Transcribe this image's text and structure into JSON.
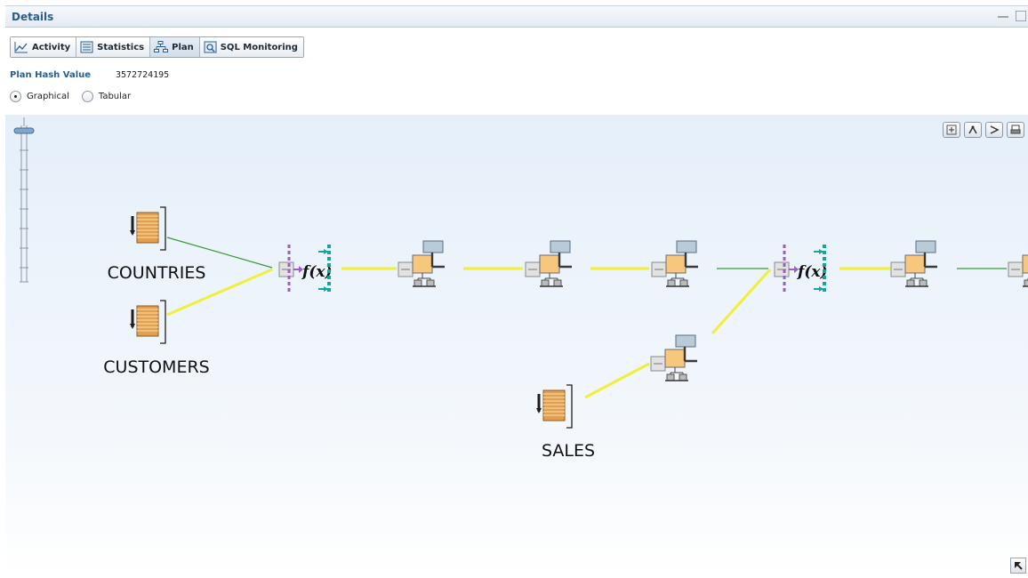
{
  "panel": {
    "title": "Details"
  },
  "tabs": [
    {
      "label": "Activity",
      "icon": "activity-chart-icon",
      "active": false
    },
    {
      "label": "Statistics",
      "icon": "statistics-table-icon",
      "active": false
    },
    {
      "label": "Plan",
      "icon": "plan-tree-icon",
      "active": true
    },
    {
      "label": "SQL Monitoring",
      "icon": "sql-monitoring-icon",
      "active": false
    }
  ],
  "plan": {
    "hash_label": "Plan Hash Value",
    "hash_value": "3572724195",
    "view_options": [
      {
        "label": "Graphical",
        "selected": true
      },
      {
        "label": "Tabular",
        "selected": false
      }
    ]
  },
  "graph": {
    "tables": [
      {
        "label": "COUNTRIES"
      },
      {
        "label": "CUSTOMERS"
      },
      {
        "label": "SALES"
      }
    ],
    "toolbar": [
      "zoom-icon",
      "expand-tree-icon",
      "collapse-tree-icon",
      "print-icon"
    ],
    "colors": {
      "heavy_edge": "#f0ef3a",
      "light_edge": "#3a9a3a",
      "canvas_top": "#e5effa"
    }
  }
}
